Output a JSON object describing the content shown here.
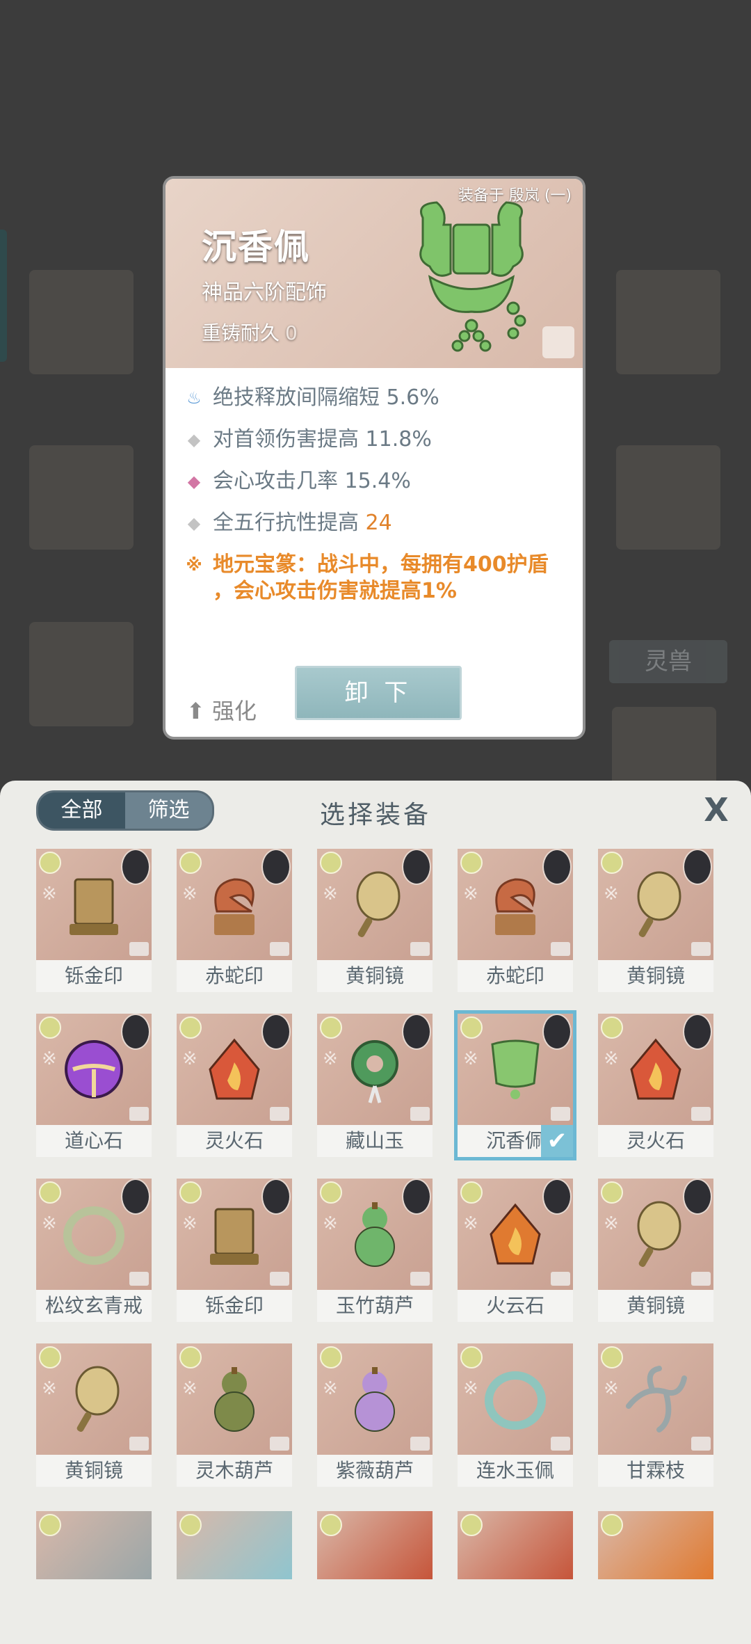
{
  "detail": {
    "equipped_on": "装备于 殷岚 (一)",
    "name": "沉香佩",
    "grade": "神品六阶配饰",
    "durability_label": "重铸耐久",
    "durability_value": "0",
    "stats": [
      {
        "mark": "♨",
        "text": "绝技释放间隔缩短 5.6%",
        "color": "#5b9ad6"
      },
      {
        "mark": "◆",
        "text": "对首领伤害提高 11.8%",
        "color": "#c3c3c3"
      },
      {
        "mark": "◆",
        "text": "会心攻击几率 15.4%",
        "color": "#d276a4"
      },
      {
        "mark": "◆",
        "text": "全五行抗性提高",
        "value": "24",
        "color": "#c3c3c3"
      }
    ],
    "special": {
      "mark": "※",
      "line1": "地元宝篆：战斗中，每拥有400护盾",
      "line2": "，会心攻击伤害就提高1%"
    },
    "enhance_label": "强化",
    "unload_label": "卸 下"
  },
  "background": {
    "label": "灵兽"
  },
  "panel": {
    "tabs": [
      "全部",
      "筛选"
    ],
    "title": "选择装备",
    "close": "X"
  },
  "items": [
    {
      "name": "铄金印",
      "icon": "seal-icon",
      "color": "#b8965d"
    },
    {
      "name": "赤蛇印",
      "icon": "serpent-seal-icon",
      "color": "#c76a44"
    },
    {
      "name": "黄铜镜",
      "icon": "mirror-icon",
      "color": "#d9c48a"
    },
    {
      "name": "赤蛇印",
      "icon": "serpent-seal-icon",
      "color": "#c76a44"
    },
    {
      "name": "黄铜镜",
      "icon": "mirror-icon",
      "color": "#d9c48a"
    },
    {
      "name": "道心石",
      "icon": "orb-icon",
      "color": "#9a4ed1"
    },
    {
      "name": "灵火石",
      "icon": "flame-stone-icon",
      "color": "#d9583a"
    },
    {
      "name": "藏山玉",
      "icon": "jade-icon",
      "color": "#4f9a5c"
    },
    {
      "name": "沉香佩",
      "icon": "pendant-icon",
      "color": "#88c66f"
    },
    {
      "name": "灵火石",
      "icon": "flame-stone-icon",
      "color": "#d9583a"
    },
    {
      "name": "松纹玄青戒",
      "icon": "ring-icon",
      "color": "#b8c39a"
    },
    {
      "name": "铄金印",
      "icon": "seal-icon",
      "color": "#b8965d"
    },
    {
      "name": "玉竹葫芦",
      "icon": "gourd-icon",
      "color": "#6fb56b"
    },
    {
      "name": "火云石",
      "icon": "fire-cloud-icon",
      "color": "#e07a30"
    },
    {
      "name": "黄铜镜",
      "icon": "mirror-icon",
      "color": "#d9c48a"
    },
    {
      "name": "黄铜镜",
      "icon": "mirror-icon",
      "color": "#d9c48a"
    },
    {
      "name": "灵木葫芦",
      "icon": "gourd-icon",
      "color": "#7e8a4a"
    },
    {
      "name": "紫薇葫芦",
      "icon": "gourd-icon",
      "color": "#b692d6"
    },
    {
      "name": "连水玉佩",
      "icon": "ring-icon",
      "color": "#8fc5bd"
    },
    {
      "name": "甘霖枝",
      "icon": "branch-icon",
      "color": "#9aa6a8"
    }
  ],
  "partial_items": [
    {
      "icon": "branch-icon",
      "color": "#9aa6a8"
    },
    {
      "icon": "pendant-icon",
      "color": "#8fc5cf"
    },
    {
      "icon": "fire-cloud-icon",
      "color": "#c6553a"
    },
    {
      "icon": "fire-cloud-icon",
      "color": "#c6553a"
    },
    {
      "icon": "fire-cloud-icon",
      "color": "#e07a30"
    }
  ],
  "selected_index": 8
}
